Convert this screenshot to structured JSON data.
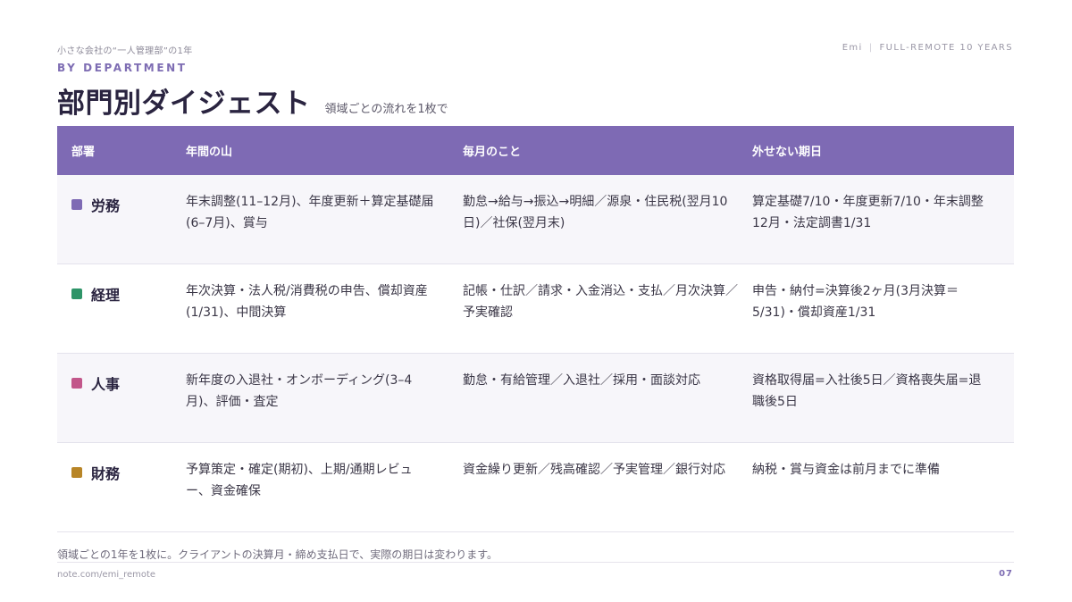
{
  "header": {
    "series_title": "小さな会社の“一人管理部”の1年",
    "author": "Emi",
    "tagline": "FULL-REMOTE 10 YEARS",
    "eyebrow": "BY DEPARTMENT",
    "title": "部門別ダイジェスト",
    "subtitle": "領域ごとの流れを1枚で"
  },
  "table": {
    "columns": [
      "部署",
      "年間の山",
      "毎月のこと",
      "外せない期日"
    ],
    "rows": [
      {
        "department": "労務",
        "color": "#7e6ab4",
        "annual_peaks": "年末調整(11–12月)、年度更新＋算定基礎届(6–7月)、賞与",
        "monthly": "勤怠→給与→振込→明細／源泉・住民税(翌月10日)／社保(翌月末)",
        "deadlines": "算定基礎7/10・年度更新7/10・年末調整12月・法定調書1/31"
      },
      {
        "department": "経理",
        "color": "#2e9468",
        "annual_peaks": "年次決算・法人税/消費税の申告、償却資産(1/31)、中間決算",
        "monthly": "記帳・仕訳／請求・入金消込・支払／月次決算／予実確認",
        "deadlines": "申告・納付=決算後2ヶ月(3月決算＝5/31)・償却資産1/31"
      },
      {
        "department": "人事",
        "color": "#c2568a",
        "annual_peaks": "新年度の入退社・オンボーディング(3–4月)、評価・査定",
        "monthly": "勤怠・有給管理／入退社／採用・面談対応",
        "deadlines": "資格取得届=入社後5日／資格喪失届=退職後5日"
      },
      {
        "department": "財務",
        "color": "#b88527",
        "annual_peaks": "予算策定・確定(期初)、上期/通期レビュー、資金確保",
        "monthly": "資金繰り更新／残高確認／予実管理／銀行対応",
        "deadlines": "納税・賞与資金は前月までに準備"
      }
    ]
  },
  "footnote": "領域ごとの1年を1枚に。クライアントの決算月・締め支払日で、実際の期日は変わります。",
  "footer": {
    "url": "note.com/emi_remote",
    "page": "07"
  }
}
